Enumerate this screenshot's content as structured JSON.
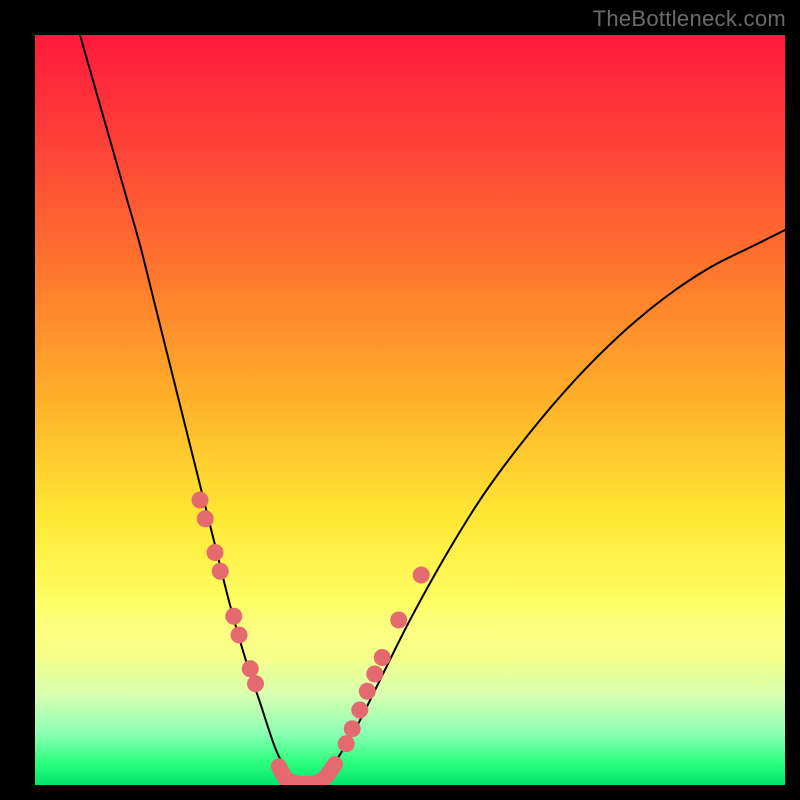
{
  "watermark": "TheBottleneck.com",
  "colors": {
    "dot": "#e46a6f",
    "curve": "#000000",
    "bg_top": "#ff1a3c",
    "bg_bottom": "#00e36a"
  },
  "chart_data": {
    "type": "line",
    "title": "",
    "xlabel": "",
    "ylabel": "",
    "xlim": [
      0,
      100
    ],
    "ylim": [
      0,
      100
    ],
    "series": [
      {
        "name": "left-curve",
        "x": [
          6,
          8,
          10,
          12,
          14,
          16,
          18,
          20,
          22,
          24,
          26,
          28,
          30,
          32,
          33.5,
          35
        ],
        "y": [
          100,
          93,
          86,
          79,
          72,
          64,
          56,
          48,
          40,
          32,
          24,
          17,
          11,
          5,
          2,
          0
        ]
      },
      {
        "name": "right-curve",
        "x": [
          38,
          40,
          43,
          46,
          50,
          55,
          60,
          66,
          72,
          78,
          84,
          90,
          96,
          100
        ],
        "y": [
          0,
          3,
          8,
          14,
          22,
          31,
          39,
          47,
          54,
          60,
          65,
          69,
          72,
          74
        ]
      }
    ],
    "markers": {
      "left_dots": [
        {
          "x": 22.0,
          "y": 38.0
        },
        {
          "x": 22.7,
          "y": 35.5
        },
        {
          "x": 24.0,
          "y": 31.0
        },
        {
          "x": 24.7,
          "y": 28.5
        },
        {
          "x": 26.5,
          "y": 22.5
        },
        {
          "x": 27.2,
          "y": 20.0
        },
        {
          "x": 28.7,
          "y": 15.5
        },
        {
          "x": 29.4,
          "y": 13.5
        }
      ],
      "right_dots": [
        {
          "x": 41.5,
          "y": 5.5
        },
        {
          "x": 42.3,
          "y": 7.5
        },
        {
          "x": 43.3,
          "y": 10.0
        },
        {
          "x": 44.3,
          "y": 12.5
        },
        {
          "x": 45.3,
          "y": 14.8
        },
        {
          "x": 46.3,
          "y": 17.0
        },
        {
          "x": 48.5,
          "y": 22.0
        },
        {
          "x": 51.5,
          "y": 28.0
        }
      ],
      "bottom_path": [
        {
          "x": 32.5,
          "y": 2.5
        },
        {
          "x": 33.5,
          "y": 0.8
        },
        {
          "x": 35.0,
          "y": 0.2
        },
        {
          "x": 37.0,
          "y": 0.2
        },
        {
          "x": 38.5,
          "y": 0.8
        },
        {
          "x": 40.0,
          "y": 2.8
        }
      ]
    }
  }
}
